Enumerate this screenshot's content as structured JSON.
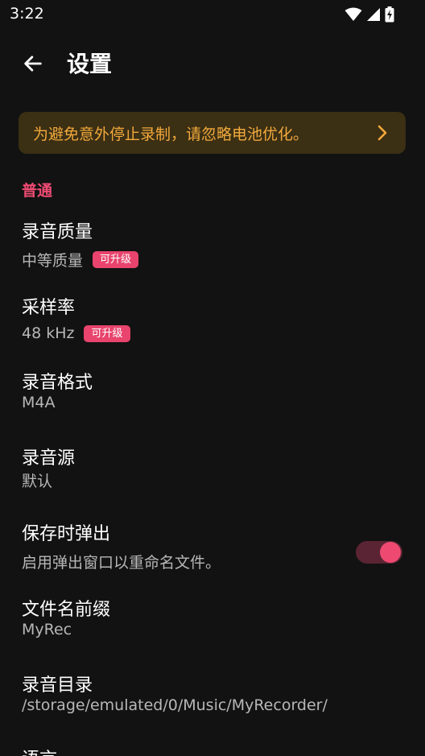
{
  "status_bar": {
    "time": "3:22",
    "icons": [
      "wifi-icon",
      "cell-signal-icon",
      "battery-charging-icon"
    ]
  },
  "app_bar": {
    "title": "设置",
    "back_icon": "arrow-left-icon"
  },
  "banner": {
    "text": "为避免意外停止录制，请忽略电池优化。",
    "icon": "chevron-right-icon",
    "text_color": "#f2a93b",
    "background": "#3b2f14"
  },
  "section": {
    "header": "普通",
    "color": "#ef4b73"
  },
  "settings": {
    "quality": {
      "title": "录音质量",
      "summary": "中等质量",
      "badge": "可升级"
    },
    "sample_rate": {
      "title": "采样率",
      "summary": "48 kHz",
      "badge": "可升级"
    },
    "format": {
      "title": "录音格式",
      "summary": "M4A"
    },
    "source": {
      "title": "录音源",
      "summary": "默认"
    },
    "popup_on_save": {
      "title": "保存时弹出",
      "summary": "启用弹出窗口以重命名文件。",
      "enabled": true
    },
    "filename_prefix": {
      "title": "文件名前缀",
      "summary": "MyRec"
    },
    "directory": {
      "title": "录音目录",
      "summary": "/storage/emulated/0/Music/MyRecorder/"
    },
    "language": {
      "title": "语言"
    }
  },
  "colors": {
    "background": "#121212",
    "accent": "#e8446d",
    "summary_text": "#b7b7b7"
  }
}
